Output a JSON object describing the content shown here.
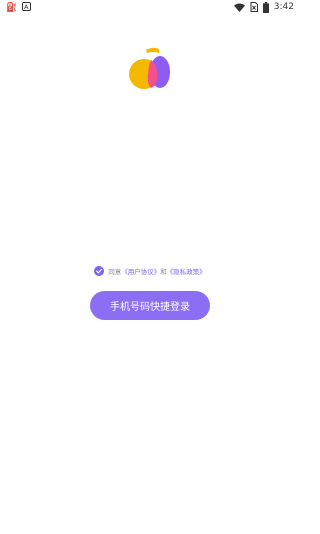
{
  "status_bar": {
    "time": "3:42",
    "left_icons": [
      "shan-icon",
      "a-badge-icon"
    ],
    "right_icons": [
      "wifi-icon",
      "no-sim-icon",
      "battery-icon"
    ]
  },
  "logo": {
    "icon": "fruit-logo-icon",
    "colors": {
      "orange": "#f5b800",
      "plum": "#8e5cf0",
      "overlap": "#f4508c"
    }
  },
  "agreement": {
    "checked": true,
    "prefix": "同意",
    "user_agreement": "《用户协议》",
    "conjunction": "和",
    "privacy_policy": "《隐私政策》"
  },
  "login": {
    "button_label": "手机号码快捷登录"
  },
  "theme": {
    "accent": "#8b6ef4",
    "link": "#7c62f0"
  }
}
